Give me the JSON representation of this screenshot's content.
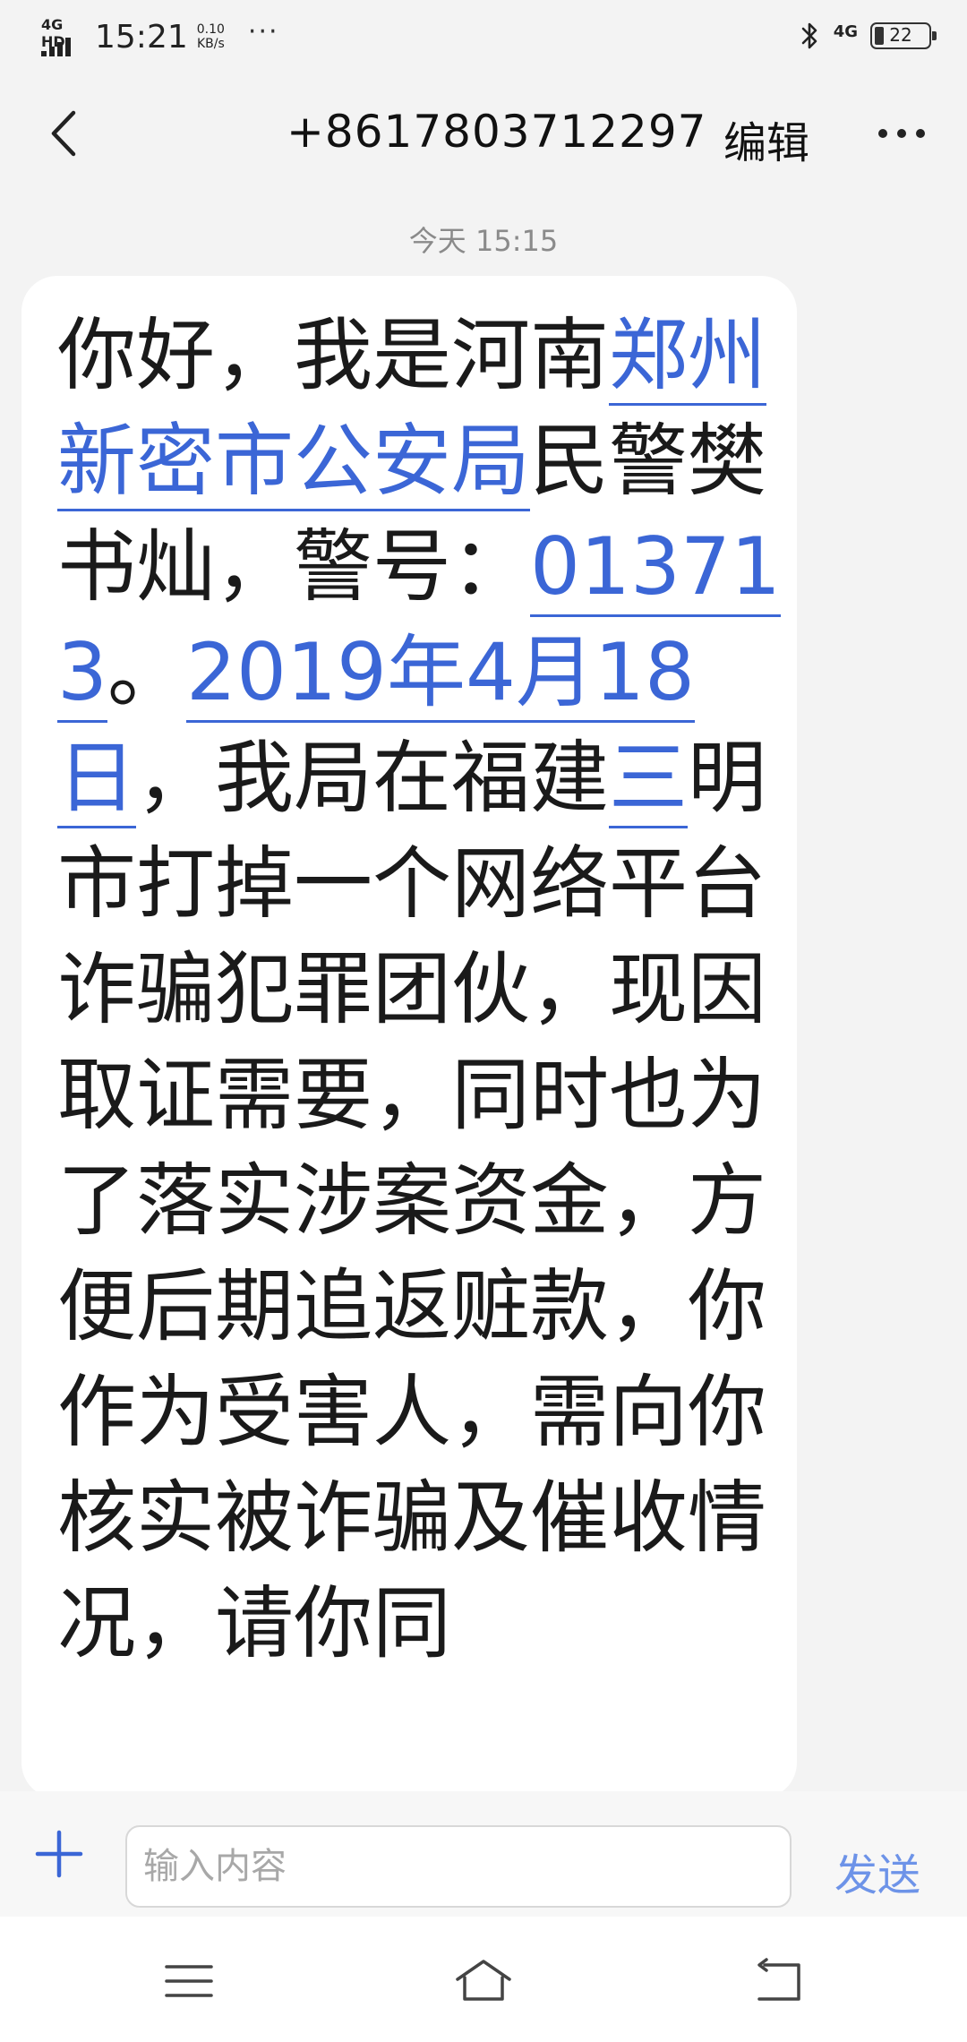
{
  "status_bar": {
    "network_label": "4G HD",
    "time": "15:21",
    "speed_value": "0.10",
    "speed_unit": "KB/s",
    "more_dots": "···",
    "signal_type": "4G",
    "battery_level": "22"
  },
  "header": {
    "back_icon": "chevron-left-icon",
    "title": "+8617803712297",
    "edit_label": "编辑",
    "more_icon": "ellipsis-icon"
  },
  "conversation": {
    "timestamp": "今天 15:15",
    "message": {
      "part1": "你好，我是河南",
      "link_place": "郑州新密市公安局",
      "part2": "民警樊书灿，警号：",
      "link_badge": "013713",
      "part3": "。",
      "link_date": "2019年4月18日",
      "part4": "，我局在福建",
      "link_num": "三",
      "part5": "明市打掉一个网络平台诈骗犯罪团伙，现因取证需要，同时也为了落实涉案资金，方便后期追返赃款，你作为受害人，需向你核实被诈骗及催收情况，请你同"
    }
  },
  "composer": {
    "add_icon": "plus-icon",
    "input_placeholder": "输入内容",
    "send_label": "发送"
  },
  "nav_bar": {
    "menu_icon": "menu-icon",
    "home_icon": "home-icon",
    "back_icon": "back-icon"
  },
  "colors": {
    "link": "#3b66d6",
    "send": "#6d93e8",
    "background": "#f3f3f3",
    "bubble": "#ffffff"
  }
}
